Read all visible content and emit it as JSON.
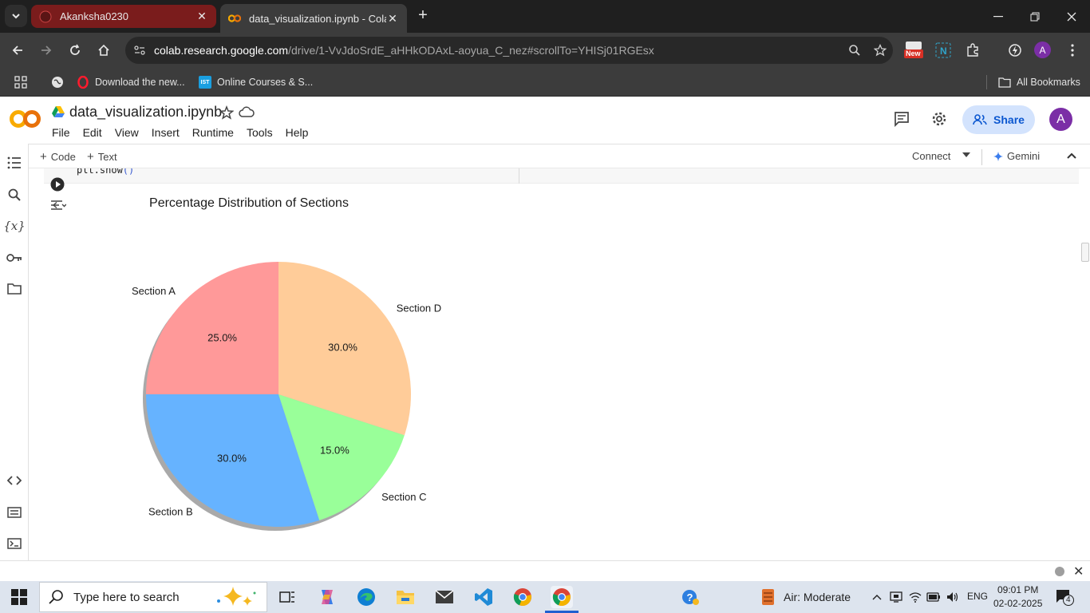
{
  "browser": {
    "tabs": [
      {
        "title": "Akanksha0230",
        "active": false
      },
      {
        "title": "data_visualization.ipynb - Colab",
        "active": true
      }
    ],
    "url_host": "colab.research.google.com",
    "url_path": "/drive/1-VvJdoSrdE_aHHkODAxL-aoyua_C_nez#scrollTo=YHISj01RGEsx",
    "extension_badge": "New",
    "profile_initial": "A"
  },
  "bookmarks": {
    "items": [
      {
        "label": "Download the new..."
      },
      {
        "label": "Online Courses & S..."
      }
    ],
    "all_bookmarks": "All Bookmarks"
  },
  "colab": {
    "notebook_title": "data_visualization.ipynb",
    "menu": [
      "File",
      "Edit",
      "View",
      "Insert",
      "Runtime",
      "Tools",
      "Help"
    ],
    "share_label": "Share",
    "avatar_initial": "A",
    "add_code": "Code",
    "add_text": "Text",
    "connect": "Connect",
    "gemini": "Gemini",
    "code_tail": "plt.show",
    "code_paren": "()"
  },
  "chart_data": {
    "type": "pie",
    "title": "Percentage Distribution of Sections",
    "slices": [
      {
        "label": "Section A",
        "value": 25.0,
        "pct_label": "25.0%",
        "color": "#ff9999"
      },
      {
        "label": "Section B",
        "value": 30.0,
        "pct_label": "30.0%",
        "color": "#66b3ff"
      },
      {
        "label": "Section C",
        "value": 15.0,
        "pct_label": "15.0%",
        "color": "#99ff99"
      },
      {
        "label": "Section D",
        "value": 30.0,
        "pct_label": "30.0%",
        "color": "#ffcc99"
      }
    ],
    "startangle_deg": 90,
    "direction": "counterclockwise",
    "shadow": true
  },
  "taskbar": {
    "search_placeholder": "Type here to search",
    "weather": "Air: Moderate",
    "language": "ENG",
    "time": "09:01 PM",
    "date": "02-02-2025",
    "notification_count": "4"
  }
}
